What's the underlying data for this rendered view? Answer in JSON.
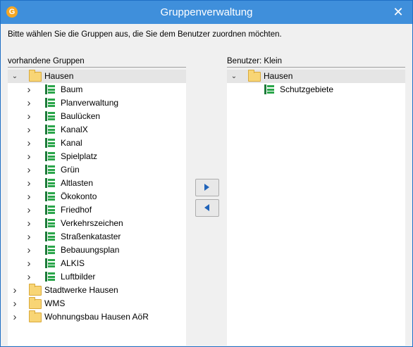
{
  "window": {
    "title": "Gruppenverwaltung",
    "app_icon": "G",
    "close_icon": "✕"
  },
  "instruction": "Bitte wählen Sie die Gruppen aus, die Sie dem Benutzer zuordnen möchten.",
  "left_panel": {
    "label": "vorhandene Gruppen",
    "root": {
      "label": "Hausen",
      "expanded": true,
      "selected": true
    },
    "children": [
      "Baum",
      "Planverwaltung",
      "Baulücken",
      "KanalX",
      "Kanal",
      "Spielplatz",
      "Grün",
      "Altlasten",
      "Ökokonto",
      "Friedhof",
      "Verkehrszeichen",
      "Straßenkataster",
      "Bebauungsplan",
      "ALKIS",
      "Luftbilder"
    ],
    "other_roots": [
      "Stadtwerke Hausen",
      "WMS",
      "Wohnungsbau Hausen AöR"
    ]
  },
  "right_panel": {
    "label": "Benutzer: Klein",
    "root": {
      "label": "Hausen",
      "expanded": true,
      "selected": true
    },
    "children": [
      "Schutzgebiete"
    ]
  },
  "buttons": {
    "add": "add-to-user",
    "remove": "remove-from-user"
  },
  "colors": {
    "titlebar": "#3f8fdb",
    "folder": "#f8d575",
    "layer": "#2aa64a",
    "arrow": "#2063b9"
  }
}
